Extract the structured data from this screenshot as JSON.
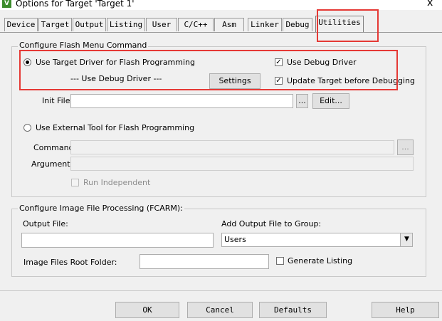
{
  "window": {
    "title": "Options for Target 'Target 1'",
    "close_glyph": "x",
    "app_icon_letter": "V"
  },
  "tabs": [
    "Device",
    "Target",
    "Output",
    "Listing",
    "User",
    "C/C++",
    "Asm",
    "Linker",
    "Debug",
    "Utilities"
  ],
  "active_tab": "Utilities",
  "flash_menu": {
    "legend": "Configure Flash Menu Command",
    "use_target_driver": {
      "label": "Use Target Driver for Flash Programming",
      "selected": true
    },
    "driver_name": "--- Use Debug Driver ---",
    "settings_button": "Settings",
    "use_debug_driver": {
      "label": "Use Debug Driver",
      "checked": true
    },
    "update_target": {
      "label": "Update Target before Debugging",
      "checked": true
    },
    "init_file": {
      "label": "Init File:",
      "value": "",
      "browse_button": "...",
      "edit_button": "Edit..."
    },
    "use_external_tool": {
      "label": "Use External Tool for Flash Programming",
      "selected": false
    },
    "command": {
      "label": "Command:",
      "value": "",
      "browse_button": "..."
    },
    "arguments": {
      "label": "Arguments:",
      "value": ""
    },
    "run_independent": {
      "label": "Run Independent",
      "checked": false
    }
  },
  "image_file": {
    "legend": "Configure Image File Processing (FCARM):",
    "output_file": {
      "label": "Output File:",
      "value": ""
    },
    "add_output_group": {
      "label": "Add Output File  to Group:",
      "value": "Users"
    },
    "root_folder": {
      "label": "Image Files Root Folder:",
      "value": ""
    },
    "generate_listing": {
      "label": "Generate Listing",
      "checked": false
    }
  },
  "footer": {
    "ok": "OK",
    "cancel": "Cancel",
    "defaults": "Defaults",
    "help": "Help"
  },
  "colors": {
    "highlight": "#e53935",
    "background": "#f0f0f0",
    "app_icon": "#3c8c2c"
  }
}
